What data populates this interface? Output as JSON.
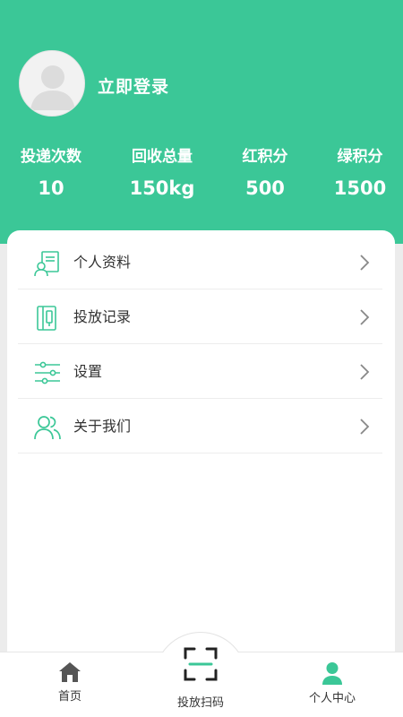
{
  "profile": {
    "login_label": "立即登录",
    "avatar_icon": "default-avatar-icon"
  },
  "stats": [
    {
      "label": "投递次数",
      "value": "10"
    },
    {
      "label": "回收总量",
      "value": "150kg"
    },
    {
      "label": "红积分",
      "value": "500"
    },
    {
      "label": "绿积分",
      "value": "1500"
    }
  ],
  "menu": [
    {
      "label": "个人资料",
      "icon": "profile-card-icon"
    },
    {
      "label": "投放记录",
      "icon": "record-book-icon"
    },
    {
      "label": "设置",
      "icon": "settings-sliders-icon"
    },
    {
      "label": "关于我们",
      "icon": "users-icon"
    }
  ],
  "tabs": [
    {
      "label": "首页",
      "icon": "home-icon"
    },
    {
      "label": "投放扫码",
      "icon": "scan-icon"
    },
    {
      "label": "个人中心",
      "icon": "person-icon"
    }
  ],
  "colors": {
    "brand": "#3bc797",
    "tab_icon_inactive": "#555555",
    "tab_icon_active": "#3bc797"
  }
}
